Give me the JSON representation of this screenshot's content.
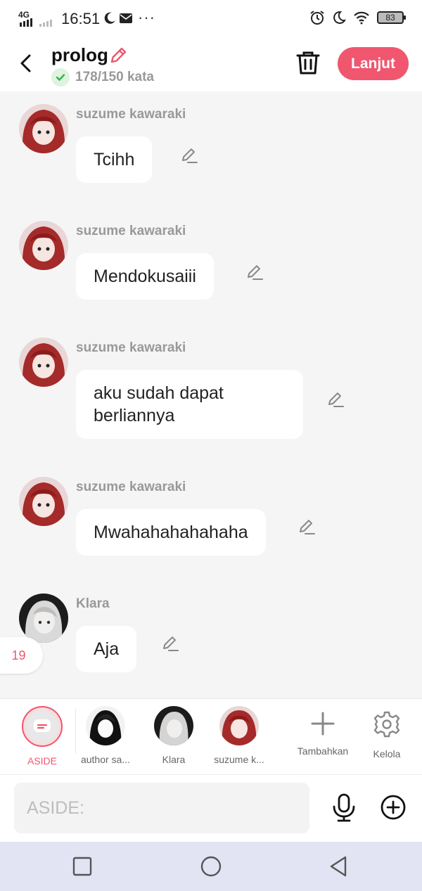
{
  "status_bar": {
    "network": "4G",
    "time": "16:51",
    "dots": "···",
    "battery": "83"
  },
  "header": {
    "title": "prolog",
    "word_count": "178/150 kata",
    "next_label": "Lanjut"
  },
  "messages": [
    {
      "sender": "suzume kawaraki",
      "text": "Tcihh",
      "avatar": "red-hair"
    },
    {
      "sender": "suzume kawaraki",
      "text": "Mendokusaiii",
      "avatar": "red-hair"
    },
    {
      "sender": "suzume kawaraki",
      "text": "aku sudah dapat berliannya",
      "avatar": "red-hair"
    },
    {
      "sender": "suzume kawaraki",
      "text": "Mwahahahahahaha",
      "avatar": "red-hair"
    },
    {
      "sender": "Klara",
      "text": "Aja",
      "avatar": "grey-hair"
    }
  ],
  "side_badge": "19",
  "characters": [
    {
      "label": "ASIDE",
      "active": true
    },
    {
      "label": "author sa..."
    },
    {
      "label": "Klara"
    },
    {
      "label": "suzume k..."
    },
    {
      "label": "Tambahkan",
      "icon": "plus-icon"
    },
    {
      "label": "Kelola",
      "icon": "gear-icon"
    }
  ],
  "input": {
    "placeholder": "ASIDE:"
  },
  "colors": {
    "accent": "#f0566e",
    "background": "#f5f5f5",
    "nav_bar": "#e2e4f4"
  }
}
